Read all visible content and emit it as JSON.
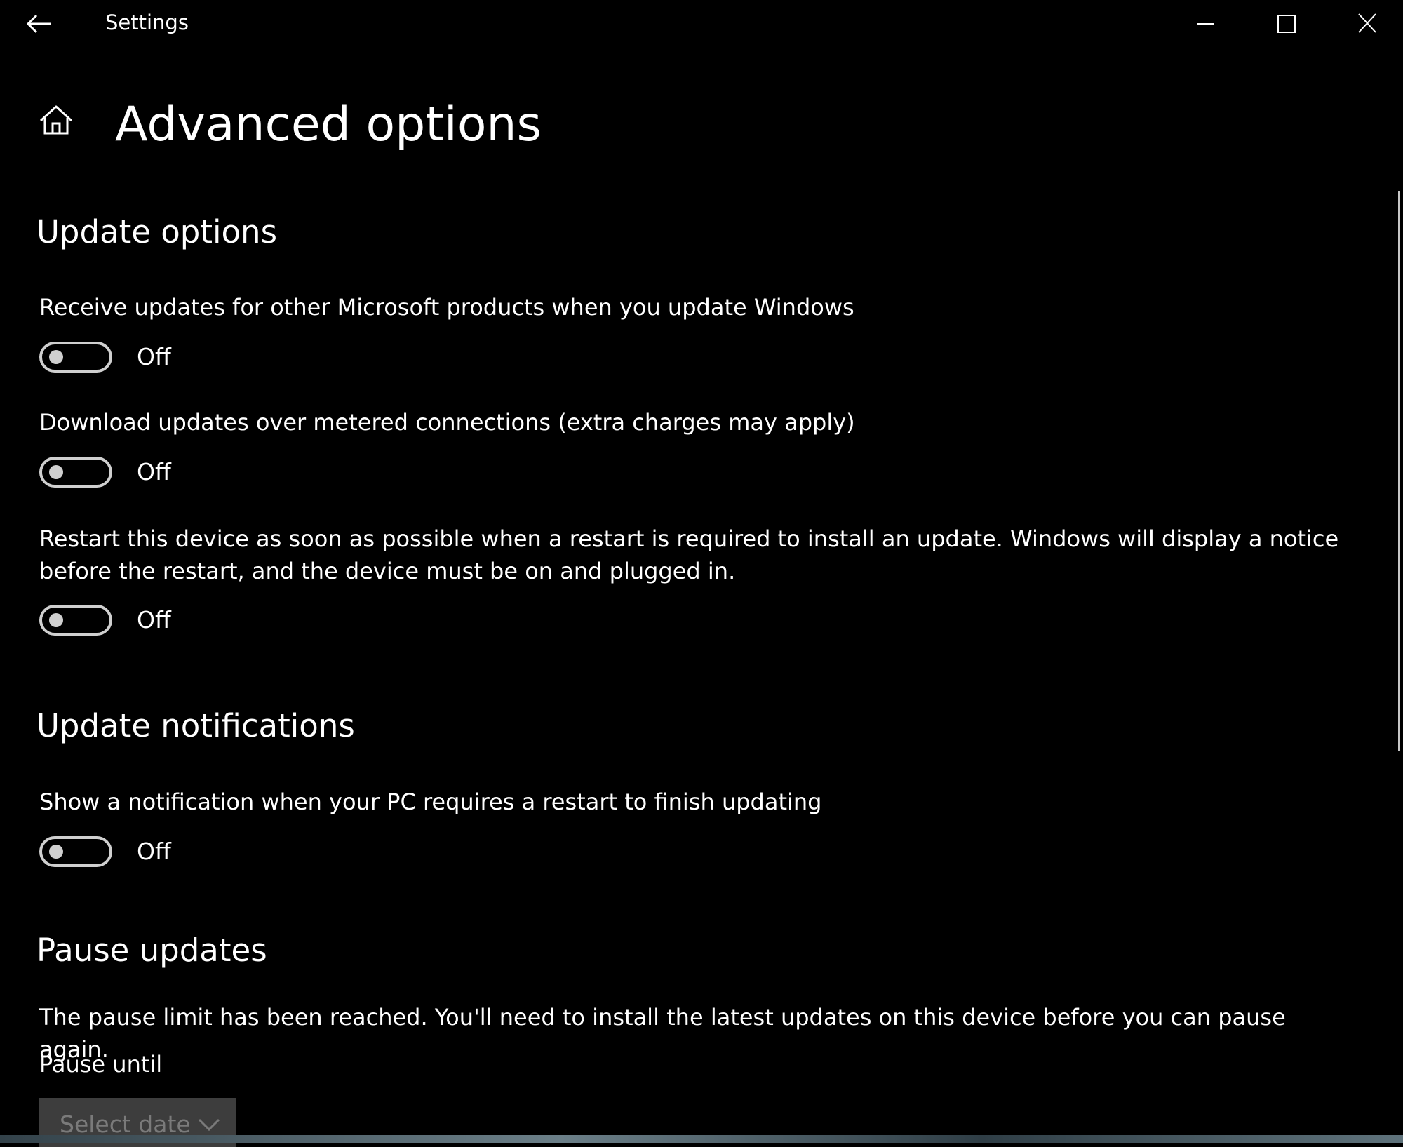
{
  "window": {
    "title": "Settings"
  },
  "header": {
    "title": "Advanced options"
  },
  "update_options": {
    "heading": "Update options",
    "items": [
      {
        "label": "Receive updates for other Microsoft products when you update Windows",
        "state": "Off"
      },
      {
        "label": "Download updates over metered connections (extra charges may apply)",
        "state": "Off"
      },
      {
        "label": "Restart this device as soon as possible when a restart is required to install an update. Windows will display a notice before the restart, and the device must be on and plugged in.",
        "state": "Off"
      }
    ]
  },
  "update_notifications": {
    "heading": "Update notifications",
    "items": [
      {
        "label": "Show a notification when your PC requires a restart to finish updating",
        "state": "Off"
      }
    ]
  },
  "pause_updates": {
    "heading": "Pause updates",
    "message": "The pause limit has been reached. You'll need to install the latest updates on this device before you can pause again.",
    "pause_until_label": "Pause until",
    "select_placeholder": "Select date"
  },
  "icons": {
    "back": "back-arrow-icon",
    "home": "home-icon",
    "minimize": "minimize-icon",
    "maximize": "maximize-icon",
    "close": "close-icon",
    "chevron": "chevron-down-icon"
  },
  "colors": {
    "background": "#000000",
    "text": "#ffffff",
    "toggle_off": "#cfcfcf",
    "select_bg": "#3d3d3d",
    "select_text": "#7a7a7a"
  }
}
